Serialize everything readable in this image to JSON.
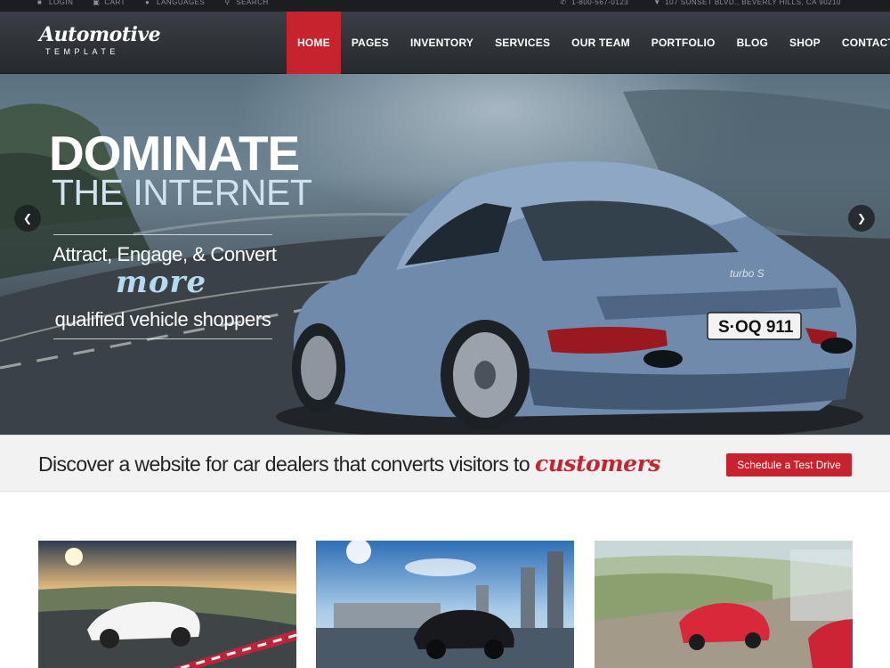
{
  "topbar": {
    "login": "LOGIN",
    "cart": "CART",
    "languages": "LANGUAGES",
    "search": "SEARCH",
    "phone": "1-800-567-0123",
    "address": "107 SUNSET BLVD., BEVERLY HILLS, CA 90210"
  },
  "logo": {
    "name": "Automotive",
    "tagline": "TEMPLATE"
  },
  "nav": {
    "items": [
      "HOME",
      "PAGES",
      "INVENTORY",
      "SERVICES",
      "OUR TEAM",
      "PORTFOLIO",
      "BLOG",
      "SHOP",
      "CONTACT"
    ],
    "active": "HOME"
  },
  "hero": {
    "headline_1": "DOMINATE",
    "headline_2": "THE INTERNET",
    "tagline_1": "Attract, Engage, & Convert",
    "tagline_2": "more",
    "tagline_3": "qualified vehicle shoppers",
    "car_badge": "turbo S",
    "license_plate": "S·OQ 911",
    "prev_arrow": "❮",
    "next_arrow": "❯"
  },
  "cta": {
    "text": "Discover a website for car dealers that converts visitors to",
    "accent": "customers",
    "button": "Schedule a Test Drive"
  },
  "colors": {
    "accent": "#c6232e",
    "header_bg": "#2e3237",
    "topbar_bg": "#1b1d20",
    "hero_text_light": "#cfe3ef"
  },
  "icons": {
    "login": "user-icon",
    "cart": "cart-icon",
    "languages": "globe-icon",
    "search": "search-icon",
    "phone": "phone-icon",
    "address": "map-pin-icon"
  }
}
